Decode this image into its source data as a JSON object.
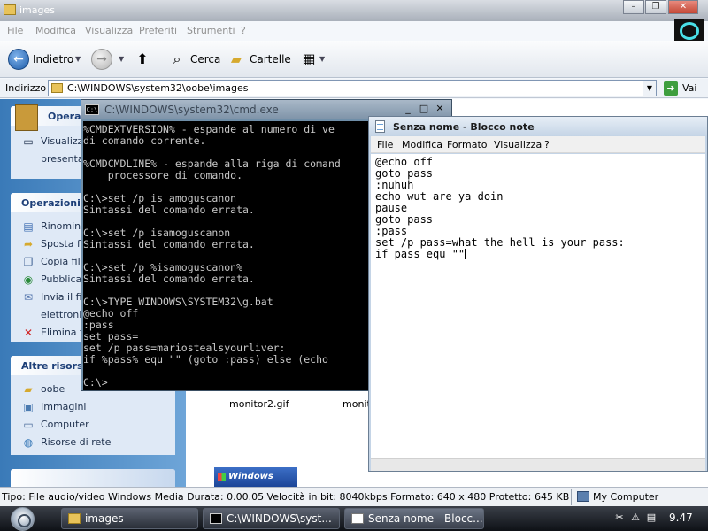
{
  "explorer": {
    "title": "images",
    "menu": [
      "File",
      "Modifica",
      "Visualizza",
      "Preferiti",
      "Strumenti",
      "?"
    ],
    "toolbar": {
      "back_label": "Indietro",
      "search_label": "Cerca",
      "folders_label": "Cartelle"
    },
    "address": {
      "label": "Indirizzo",
      "path": "C:\\WINDOWS\\system32\\oobe\\images",
      "go_label": "Vai"
    },
    "taskpane": {
      "view_partial": [
        "Visualizz",
        "presenta"
      ],
      "ops_header_partial": "Operaz",
      "operations_header": "Operazioni",
      "operations": [
        "Rinomina",
        "Sposta fi",
        "Copia file",
        "Pubblica",
        "Invia il fi",
        "elettroni",
        "Elimina fi"
      ],
      "other_header": "Altre risorse",
      "other": [
        "oobe",
        "Immagini",
        "Computer",
        "Risorse di rete"
      ]
    },
    "files": [
      "monitor2.gif",
      "monito"
    ],
    "thumb_logo": "Windows",
    "status": {
      "text": "Tipo: File audio/video Windows Media Durata: 0.00.05 Velocità in bit: 8040kbps Formato: 640 x 480 Protetto: No Dimen",
      "size": "645 KB",
      "location": "My Computer"
    }
  },
  "cmd": {
    "title": "C:\\WINDOWS\\system32\\cmd.exe",
    "icon_text": "C:\\",
    "lines": [
      "%CMDEXTVERSION% - espande al numero di ve",
      "di comando corrente.",
      "",
      "%CMDCMDLINE% - espande alla riga di comand",
      "    processore di comando.",
      "",
      "C:\\>set /p is amoguscanon",
      "Sintassi del comando errata.",
      "",
      "C:\\>set /p isamoguscanon",
      "Sintassi del comando errata.",
      "",
      "C:\\>set /p %isamoguscanon%",
      "Sintassi del comando errata.",
      "",
      "C:\\>TYPE WINDOWS\\SYSTEM32\\g.bat",
      "@echo off",
      ":pass",
      "set pass=",
      "set /p pass=mariostealsyourliver:",
      "if %pass% equ \"\" (goto :pass) else (echo",
      "",
      "C:\\>"
    ]
  },
  "notepad": {
    "title": "Senza nome - Blocco note",
    "menu": [
      "File",
      "Modifica",
      "Formato",
      "Visualizza",
      "?"
    ],
    "lines": [
      "@echo off",
      "goto pass",
      ":nuhuh",
      "echo wut are ya doin",
      "pause",
      "goto pass",
      ":pass",
      "set /p pass=what the hell is your pass:",
      "if pass equ \"\""
    ]
  },
  "taskbar": {
    "items": [
      "images",
      "C:\\WINDOWS\\syst...",
      "Senza nome - Blocc..."
    ],
    "clock": "9.47"
  },
  "colors": {
    "cmd_background": "#000000",
    "cmd_text": "#c8c8c8",
    "taskpane_blue": "#3a7ab8",
    "taskbar": "#1b1f26"
  }
}
